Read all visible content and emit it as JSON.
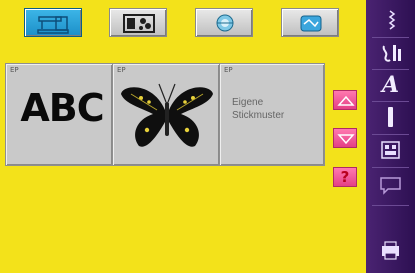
{
  "mode_buttons": [
    {
      "name": "sewing-mode",
      "icon": "sewing-machine-icon",
      "active": true
    },
    {
      "name": "embroidery-mode",
      "icon": "embroidery-module-icon",
      "active": false
    },
    {
      "name": "settings-mode",
      "icon": "setup-program-icon",
      "active": false
    },
    {
      "name": "personal-mode",
      "icon": "personal-program-icon",
      "active": false
    }
  ],
  "designs": [
    {
      "tag": "EP",
      "label": "ABC",
      "icon": "alphabet-icon"
    },
    {
      "tag": "EP",
      "label": "",
      "icon": "butterfly-icon"
    },
    {
      "tag": "EP",
      "label": "Eigene\nStickmuster",
      "icon": "own-designs-icon"
    }
  ],
  "side_buttons": {
    "scroll_up": "scroll-up-icon",
    "scroll_down": "scroll-down-icon",
    "help_label": "?"
  },
  "sidebar": {
    "items": [
      {
        "name": "pattern-list",
        "icon": "pattern-list-icon"
      },
      {
        "name": "stitch-settings",
        "icon": "stitch-settings-icon"
      },
      {
        "name": "alphabets",
        "label": "A",
        "icon": "alphabet-letter-icon"
      },
      {
        "name": "thread-tension",
        "icon": "tension-bar-icon"
      },
      {
        "name": "memory",
        "icon": "memory-icon"
      },
      {
        "name": "tutorial",
        "icon": "speech-bubble-icon"
      },
      {
        "name": "print-export",
        "icon": "printer-icon"
      }
    ]
  },
  "colors": {
    "background": "#f3e21a",
    "sidebar": "#3a1862",
    "accent": "#e43f85",
    "active_button": "#2aa3d9"
  }
}
